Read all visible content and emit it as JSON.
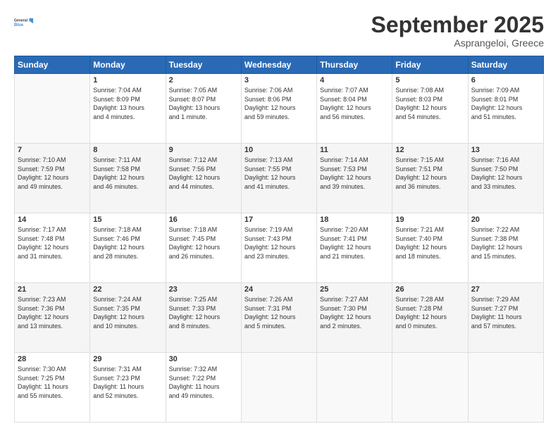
{
  "header": {
    "logo_line1": "General",
    "logo_line2": "Blue",
    "month": "September 2025",
    "location": "Asprangeloi, Greece"
  },
  "weekdays": [
    "Sunday",
    "Monday",
    "Tuesday",
    "Wednesday",
    "Thursday",
    "Friday",
    "Saturday"
  ],
  "weeks": [
    [
      {
        "num": "",
        "info": ""
      },
      {
        "num": "1",
        "info": "Sunrise: 7:04 AM\nSunset: 8:09 PM\nDaylight: 13 hours\nand 4 minutes."
      },
      {
        "num": "2",
        "info": "Sunrise: 7:05 AM\nSunset: 8:07 PM\nDaylight: 13 hours\nand 1 minute."
      },
      {
        "num": "3",
        "info": "Sunrise: 7:06 AM\nSunset: 8:06 PM\nDaylight: 12 hours\nand 59 minutes."
      },
      {
        "num": "4",
        "info": "Sunrise: 7:07 AM\nSunset: 8:04 PM\nDaylight: 12 hours\nand 56 minutes."
      },
      {
        "num": "5",
        "info": "Sunrise: 7:08 AM\nSunset: 8:03 PM\nDaylight: 12 hours\nand 54 minutes."
      },
      {
        "num": "6",
        "info": "Sunrise: 7:09 AM\nSunset: 8:01 PM\nDaylight: 12 hours\nand 51 minutes."
      }
    ],
    [
      {
        "num": "7",
        "info": "Sunrise: 7:10 AM\nSunset: 7:59 PM\nDaylight: 12 hours\nand 49 minutes."
      },
      {
        "num": "8",
        "info": "Sunrise: 7:11 AM\nSunset: 7:58 PM\nDaylight: 12 hours\nand 46 minutes."
      },
      {
        "num": "9",
        "info": "Sunrise: 7:12 AM\nSunset: 7:56 PM\nDaylight: 12 hours\nand 44 minutes."
      },
      {
        "num": "10",
        "info": "Sunrise: 7:13 AM\nSunset: 7:55 PM\nDaylight: 12 hours\nand 41 minutes."
      },
      {
        "num": "11",
        "info": "Sunrise: 7:14 AM\nSunset: 7:53 PM\nDaylight: 12 hours\nand 39 minutes."
      },
      {
        "num": "12",
        "info": "Sunrise: 7:15 AM\nSunset: 7:51 PM\nDaylight: 12 hours\nand 36 minutes."
      },
      {
        "num": "13",
        "info": "Sunrise: 7:16 AM\nSunset: 7:50 PM\nDaylight: 12 hours\nand 33 minutes."
      }
    ],
    [
      {
        "num": "14",
        "info": "Sunrise: 7:17 AM\nSunset: 7:48 PM\nDaylight: 12 hours\nand 31 minutes."
      },
      {
        "num": "15",
        "info": "Sunrise: 7:18 AM\nSunset: 7:46 PM\nDaylight: 12 hours\nand 28 minutes."
      },
      {
        "num": "16",
        "info": "Sunrise: 7:18 AM\nSunset: 7:45 PM\nDaylight: 12 hours\nand 26 minutes."
      },
      {
        "num": "17",
        "info": "Sunrise: 7:19 AM\nSunset: 7:43 PM\nDaylight: 12 hours\nand 23 minutes."
      },
      {
        "num": "18",
        "info": "Sunrise: 7:20 AM\nSunset: 7:41 PM\nDaylight: 12 hours\nand 21 minutes."
      },
      {
        "num": "19",
        "info": "Sunrise: 7:21 AM\nSunset: 7:40 PM\nDaylight: 12 hours\nand 18 minutes."
      },
      {
        "num": "20",
        "info": "Sunrise: 7:22 AM\nSunset: 7:38 PM\nDaylight: 12 hours\nand 15 minutes."
      }
    ],
    [
      {
        "num": "21",
        "info": "Sunrise: 7:23 AM\nSunset: 7:36 PM\nDaylight: 12 hours\nand 13 minutes."
      },
      {
        "num": "22",
        "info": "Sunrise: 7:24 AM\nSunset: 7:35 PM\nDaylight: 12 hours\nand 10 minutes."
      },
      {
        "num": "23",
        "info": "Sunrise: 7:25 AM\nSunset: 7:33 PM\nDaylight: 12 hours\nand 8 minutes."
      },
      {
        "num": "24",
        "info": "Sunrise: 7:26 AM\nSunset: 7:31 PM\nDaylight: 12 hours\nand 5 minutes."
      },
      {
        "num": "25",
        "info": "Sunrise: 7:27 AM\nSunset: 7:30 PM\nDaylight: 12 hours\nand 2 minutes."
      },
      {
        "num": "26",
        "info": "Sunrise: 7:28 AM\nSunset: 7:28 PM\nDaylight: 12 hours\nand 0 minutes."
      },
      {
        "num": "27",
        "info": "Sunrise: 7:29 AM\nSunset: 7:27 PM\nDaylight: 11 hours\nand 57 minutes."
      }
    ],
    [
      {
        "num": "28",
        "info": "Sunrise: 7:30 AM\nSunset: 7:25 PM\nDaylight: 11 hours\nand 55 minutes."
      },
      {
        "num": "29",
        "info": "Sunrise: 7:31 AM\nSunset: 7:23 PM\nDaylight: 11 hours\nand 52 minutes."
      },
      {
        "num": "30",
        "info": "Sunrise: 7:32 AM\nSunset: 7:22 PM\nDaylight: 11 hours\nand 49 minutes."
      },
      {
        "num": "",
        "info": ""
      },
      {
        "num": "",
        "info": ""
      },
      {
        "num": "",
        "info": ""
      },
      {
        "num": "",
        "info": ""
      }
    ]
  ]
}
